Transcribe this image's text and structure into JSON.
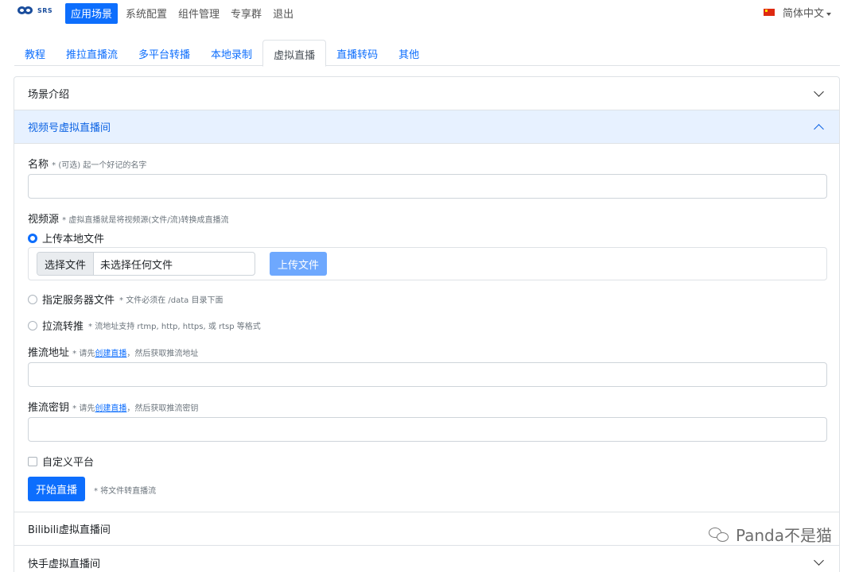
{
  "logo": {
    "text": "SRS"
  },
  "topnav": {
    "items": [
      {
        "label": "应用场景",
        "active": true
      },
      {
        "label": "系统配置",
        "active": false
      },
      {
        "label": "组件管理",
        "active": false
      },
      {
        "label": "专享群",
        "active": false
      },
      {
        "label": "退出",
        "active": false
      }
    ],
    "language": "简体中文"
  },
  "tabs": [
    {
      "label": "教程",
      "active": false
    },
    {
      "label": "推拉直播流",
      "active": false
    },
    {
      "label": "多平台转播",
      "active": false
    },
    {
      "label": "本地录制",
      "active": false
    },
    {
      "label": "虚拟直播",
      "active": true
    },
    {
      "label": "直播转码",
      "active": false
    },
    {
      "label": "其他",
      "active": false
    }
  ],
  "accordion": {
    "intro": {
      "title": "场景介绍"
    },
    "wechat": {
      "title": "视频号虚拟直播间",
      "name_label": "名称",
      "name_hint": "* (可选) 起一个好记的名字",
      "name_value": "",
      "source_label": "视频源",
      "source_hint": "* 虚拟直播就是将视频源(文件/流)转换成直播流",
      "source_options": {
        "upload": {
          "label": "上传本地文件",
          "checked": true
        },
        "server": {
          "label": "指定服务器文件",
          "hint": "* 文件必须在 /data 目录下面",
          "checked": false
        },
        "pull": {
          "label": "拉流转推",
          "hint": "* 流地址支持 rtmp, http, https, 或 rtsp 等格式",
          "checked": false
        }
      },
      "file_button": "选择文件",
      "file_status": "未选择任何文件",
      "upload_button": "上传文件",
      "push_url_label": "推流地址",
      "push_url_hint_pre": "* 请先",
      "push_url_hint_link": "创建直播",
      "push_url_hint_post": "，然后获取推流地址",
      "push_url_value": "",
      "push_key_label": "推流密钥",
      "push_key_hint_pre": "* 请先",
      "push_key_hint_link": "创建直播",
      "push_key_hint_post": "，然后获取推流密钥",
      "push_key_value": "",
      "custom_platform_label": "自定义平台",
      "custom_platform_checked": false,
      "start_button": "开始直播",
      "start_hint": "* 将文件转直播流"
    },
    "bilibili": {
      "title": "Bilibili虚拟直播间"
    },
    "kuaishou": {
      "title": "快手虚拟直播间"
    }
  },
  "watermark": {
    "text": "Panda不是猫"
  },
  "colors": {
    "primary": "#0d6efd",
    "primary_light": "#6ea8fe",
    "header_open_bg": "#e7f1ff"
  }
}
